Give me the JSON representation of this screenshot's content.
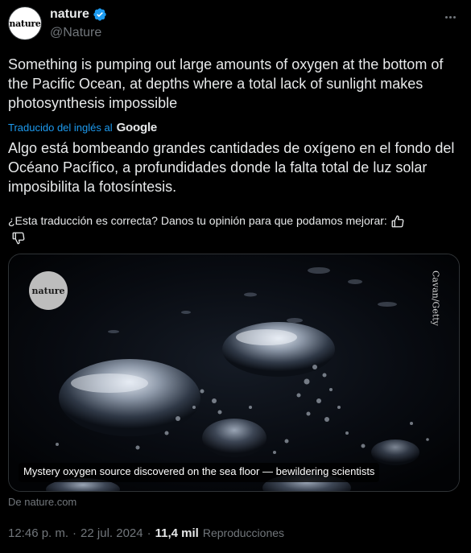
{
  "author": {
    "display_name": "nature",
    "handle": "@Nature",
    "avatar_text": "nature",
    "verified": true
  },
  "tweet": {
    "text": "Something is pumping out large amounts of oxygen at the bottom of the Pacific Ocean, at depths where a total lack of sunlight makes photosynthesis impossible",
    "translated_label": "Traducido del inglés al",
    "translator": "Google",
    "translation": "Algo está bombeando grandes cantidades de oxígeno en el fondo del Océano Pacífico, a profundidades donde la falta total de luz solar imposibilita la fotosíntesis.",
    "feedback_prompt": "¿Esta traducción es correcta? Danos tu opinión para que podamos mejorar:"
  },
  "card": {
    "logo_text": "nature",
    "credit": "Cavan/Getty",
    "caption": "Mystery oxygen source discovered on the sea floor — bewildering scientists",
    "source": "De nature.com"
  },
  "meta": {
    "time": "12:46 p. m.",
    "separator1": "·",
    "date": "22 jul. 2024",
    "separator2": "·",
    "views_count": "11,4 mil",
    "views_label": "Reproducciones"
  },
  "colors": {
    "background": "#000000",
    "text": "#e7e9ea",
    "secondary": "#71767b",
    "link": "#1d9bf0",
    "verified": "#1d9bf0"
  },
  "icons": [
    "verified-badge-icon",
    "more-options-icon",
    "thumbs-up-icon",
    "thumbs-down-icon"
  ]
}
